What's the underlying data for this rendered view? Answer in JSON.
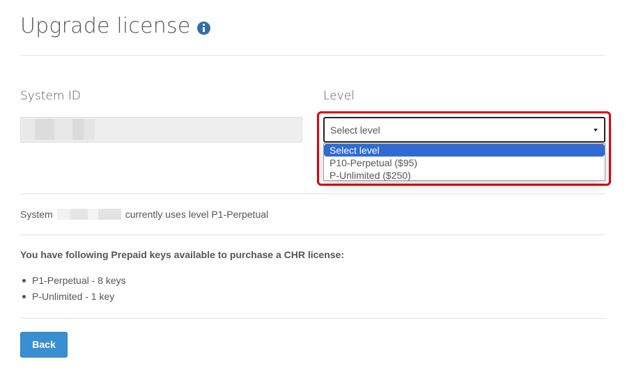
{
  "header": {
    "title": "Upgrade license",
    "info_icon": "info-circle-icon"
  },
  "form": {
    "system_id": {
      "label": "System ID",
      "value_redacted": true
    },
    "level": {
      "label": "Level",
      "placeholder": "Select level",
      "options": [
        "Select level",
        "P10-Perpetual ($95)",
        "P-Unlimited ($250)"
      ],
      "highlighted_option": "Select level"
    }
  },
  "status": {
    "prefix": "System",
    "suffix": "currently uses level P1-Perpetual"
  },
  "prepaid": {
    "heading": "You have following Prepaid keys available to purchase a CHR license:",
    "keys": [
      "P1-Perpetual - 8 keys",
      "P-Unlimited - 1 key"
    ]
  },
  "actions": {
    "back_label": "Back"
  },
  "colors": {
    "primary_button": "#3a8fd0",
    "selected_option": "#2f6bd3",
    "highlight_border": "#e00012",
    "info_icon": "#2f6fa8"
  }
}
